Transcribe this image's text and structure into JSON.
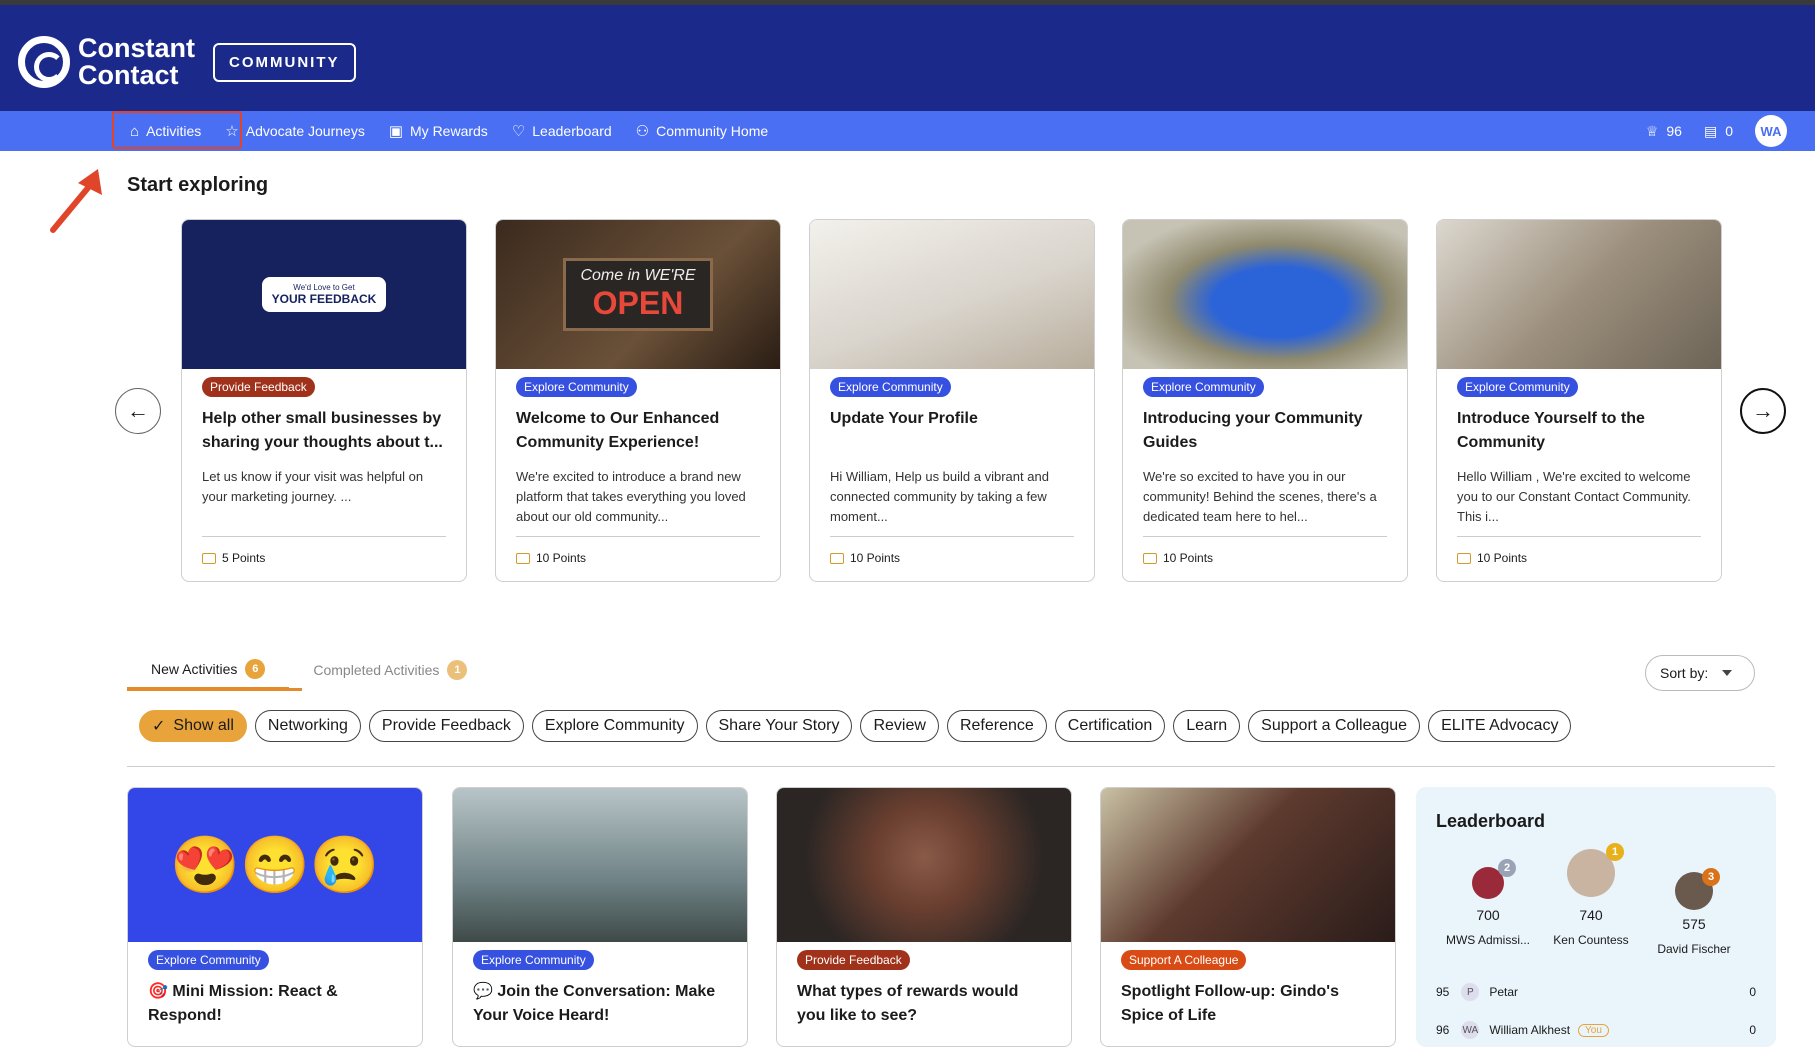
{
  "brand": {
    "name_line1": "Constant",
    "name_line2": "Contact",
    "community_label": "COMMUNITY"
  },
  "nav": {
    "items": [
      {
        "label": "Activities",
        "icon": "home-icon"
      },
      {
        "label": "Advocate Journeys",
        "icon": "star-icon"
      },
      {
        "label": "My Rewards",
        "icon": "gift-icon"
      },
      {
        "label": "Leaderboard",
        "icon": "trophy-icon"
      },
      {
        "label": "Community Home",
        "icon": "people-icon"
      }
    ],
    "badges_count": "96",
    "points_count": "0",
    "avatar_initials": "WA"
  },
  "explore": {
    "title": "Start exploring",
    "cards": [
      {
        "tag": "Provide Feedback",
        "title": "Help other small businesses by sharing your thoughts about t...",
        "desc": "Let us know if your visit was helpful on your marketing journey. ...",
        "points": "5 Points",
        "image_text_small": "We'd Love to Get",
        "image_text_big": "YOUR FEEDBACK"
      },
      {
        "tag": "Explore Community",
        "title": "Welcome to Our Enhanced Community Experience!",
        "desc": "We're excited to introduce a brand new platform that takes everything you loved about our old community...",
        "points": "10 Points",
        "image_text_small": "Come in WE'RE",
        "image_text_big": "OPEN"
      },
      {
        "tag": "Explore Community",
        "title": "Update Your Profile",
        "desc": "Hi William, Help us build a vibrant and connected community by taking a few moment...",
        "points": "10 Points"
      },
      {
        "tag": "Explore Community",
        "title": "Introducing your Community Guides",
        "desc": "We're so excited to have you in our community! Behind the scenes, there's a dedicated team here to hel...",
        "points": "10 Points"
      },
      {
        "tag": "Explore Community",
        "title": "Introduce Yourself to the Community",
        "desc": "Hello William , We're excited to welcome you to our Constant Contact Community. This i...",
        "points": "10 Points"
      }
    ]
  },
  "tabs": [
    {
      "label": "New Activities",
      "count": "6"
    },
    {
      "label": "Completed Activities",
      "count": "1"
    }
  ],
  "sort_label": "Sort by:",
  "filters": [
    "Show all",
    "Networking",
    "Provide Feedback",
    "Explore Community",
    "Share Your Story",
    "Review",
    "Reference",
    "Certification",
    "Learn",
    "Support a Colleague",
    "ELITE Advocacy"
  ],
  "activities": [
    {
      "tag": "Explore Community",
      "title": "🎯 Mini Mission: React & Respond!"
    },
    {
      "tag": "Explore Community",
      "title": "💬 Join the Conversation: Make Your Voice Heard!"
    },
    {
      "tag": "Provide Feedback",
      "title": "What types of rewards would you like to see?"
    },
    {
      "tag": "Support A Colleague",
      "title": "Spotlight Follow-up: Gindo's Spice of Life"
    }
  ],
  "leaderboard": {
    "title": "Leaderboard",
    "podium": [
      {
        "rank": "2",
        "points": "700",
        "name": "MWS Admissi..."
      },
      {
        "rank": "1",
        "points": "740",
        "name": "Ken Countess"
      },
      {
        "rank": "3",
        "points": "575",
        "name": "David Fischer"
      }
    ],
    "rows": [
      {
        "rank": "95",
        "initial": "P",
        "name": "Petar",
        "points": "0"
      },
      {
        "rank": "96",
        "initial": "WA",
        "name": "William Alkhest",
        "you": "You",
        "points": "0"
      }
    ]
  },
  "colors": {
    "header": "#1b2a8a",
    "nav": "#4a6ff3",
    "accent": "#e8a33a",
    "tag_blue": "#3650e0"
  }
}
